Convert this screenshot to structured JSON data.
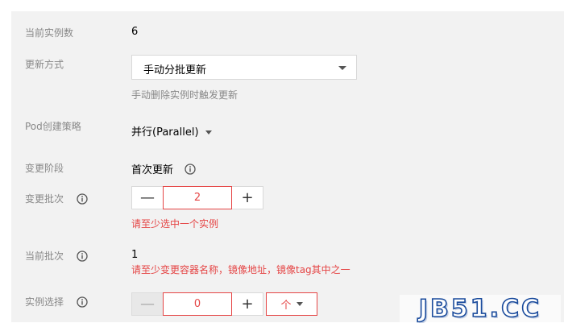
{
  "rows": {
    "current_instances": {
      "label": "当前实例数",
      "value": "6"
    },
    "update_mode": {
      "label": "更新方式",
      "selected": "手动分批更新",
      "hint": "手动删除实例时触发更新"
    },
    "pod_policy": {
      "label": "Pod创建策略",
      "value": "并行(Parallel)"
    },
    "change_stage": {
      "label": "变更阶段",
      "value": "首次更新"
    },
    "change_batch": {
      "label": "变更批次",
      "value": "2",
      "error": "请至少选中一个实例"
    },
    "current_batch": {
      "label": "当前批次",
      "value": "1",
      "error": "请至少变更容器名称，镜像地址，镜像tag其中之一"
    },
    "instance_select": {
      "label": "实例选择",
      "value": "0",
      "unit": "个"
    }
  },
  "stepper": {
    "minus": "—",
    "plus": "+"
  },
  "watermark": "JB51.CC",
  "icons": {
    "info": "info-circle-icon",
    "caret": "caret-down-icon"
  },
  "colors": {
    "error": "#e54545",
    "label": "#888888",
    "panel_bg": "#f2f2f2",
    "watermark": "#1a4b9c"
  }
}
